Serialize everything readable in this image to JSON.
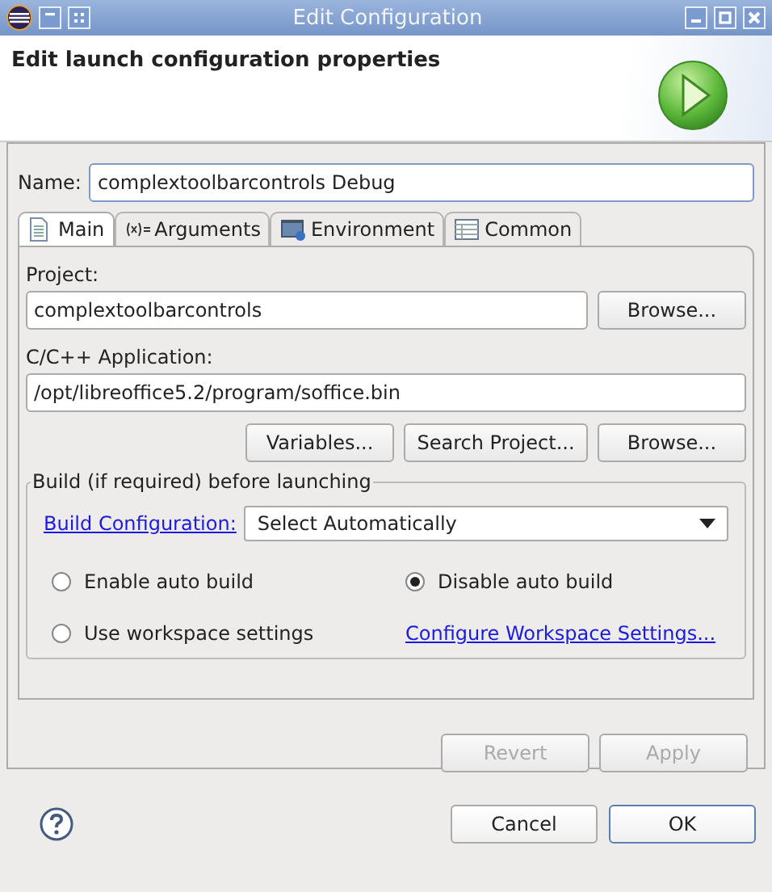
{
  "window": {
    "title": "Edit Configuration"
  },
  "header": {
    "title": "Edit launch configuration properties"
  },
  "name": {
    "label": "Name:",
    "value": "complextoolbarcontrols Debug"
  },
  "tabs": [
    {
      "label": "Main",
      "selected": true
    },
    {
      "label": "Arguments",
      "selected": false
    },
    {
      "label": "Environment",
      "selected": false
    },
    {
      "label": "Common",
      "selected": false
    }
  ],
  "main": {
    "project": {
      "label": "Project:",
      "value": "complextoolbarcontrols",
      "button": "Browse..."
    },
    "application": {
      "label": "C/C++ Application:",
      "value": "/opt/libreoffice5.2/program/soffice.bin",
      "buttons": [
        "Variables...",
        "Search Project...",
        "Browse..."
      ]
    },
    "build": {
      "legend": "Build (if required) before launching",
      "config_link": "Build Configuration:",
      "config_value": "Select Automatically",
      "options": [
        {
          "label": "Enable auto build",
          "selected": false
        },
        {
          "label": "Disable auto build",
          "selected": true
        },
        {
          "label": "Use workspace settings",
          "selected": false
        }
      ],
      "workspace_link": "Configure Workspace Settings..."
    }
  },
  "panel_buttons": [
    {
      "label": "Revert",
      "disabled": true
    },
    {
      "label": "Apply",
      "disabled": true
    }
  ],
  "dialog_buttons": [
    {
      "label": "Cancel",
      "default": false
    },
    {
      "label": "OK",
      "default": true
    }
  ]
}
